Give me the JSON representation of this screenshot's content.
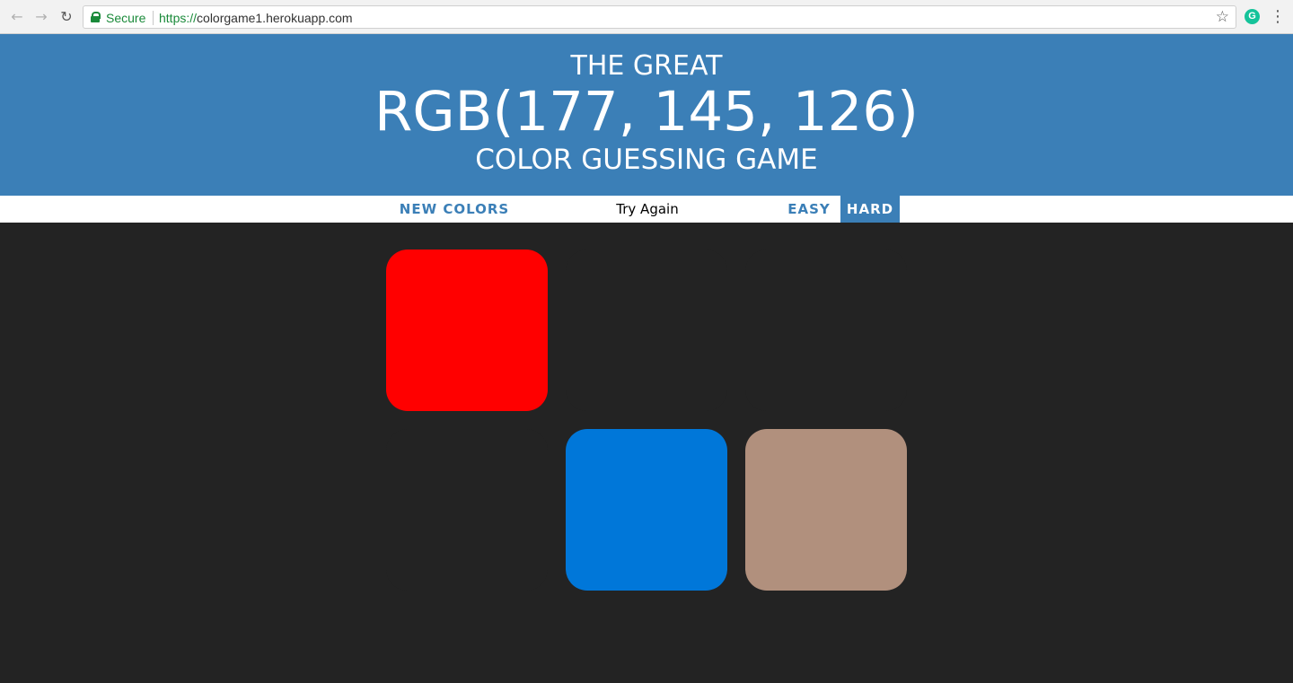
{
  "browser": {
    "secure_label": "Secure",
    "url_scheme": "https://",
    "url_host": "colorgame1.herokuapp.com",
    "back_icon": "arrow-left-icon",
    "forward_icon": "arrow-right-icon",
    "reload_icon": "reload-icon",
    "bookmark_icon": "star-icon",
    "extension_letter": "G",
    "extension_color": "#15c39a"
  },
  "header": {
    "line1": "THE GREAT",
    "target_color": "RGB(177, 145, 126)",
    "line3": "COLOR GUESSING GAME",
    "background": "#3b7fb7"
  },
  "controls": {
    "new_colors_label": "NEW COLORS",
    "message": "Try Again",
    "easy_label": "EASY",
    "hard_label": "HARD",
    "selected_mode": "HARD"
  },
  "board": {
    "background": "#232323",
    "squares": [
      {
        "color": "#ff0000"
      },
      {
        "color": "#232323"
      },
      {
        "color": "#232323"
      },
      {
        "color": "#232323"
      },
      {
        "color": "#0077d9"
      },
      {
        "color": "#b1907d"
      }
    ]
  }
}
